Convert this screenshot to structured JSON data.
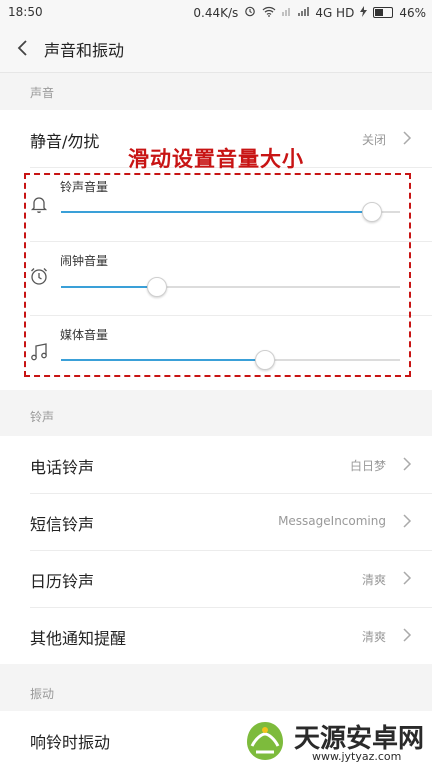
{
  "status_bar": {
    "time": "18:50",
    "speed": "0.44K/s",
    "network": "4G HD",
    "battery": "46%",
    "battery_level": 0.46
  },
  "header": {
    "title": "声音和振动"
  },
  "sound_section": {
    "label": "声音",
    "dnd": {
      "label": "静音/勿扰",
      "value": "关闭"
    },
    "volumes": [
      {
        "label": "铃声音量",
        "icon": "bell-icon",
        "level": 0.915
      },
      {
        "label": "闹钟音量",
        "icon": "alarm-clock-icon",
        "level": 0.28
      },
      {
        "label": "媒体音量",
        "icon": "music-note-icon",
        "level": 0.6
      }
    ]
  },
  "ringtone_section": {
    "label": "铃声",
    "items": [
      {
        "label": "电话铃声",
        "value": "白日梦"
      },
      {
        "label": "短信铃声",
        "value": "MessageIncoming"
      },
      {
        "label": "日历铃声",
        "value": "清爽"
      },
      {
        "label": "其他通知提醒",
        "value": "清爽"
      }
    ]
  },
  "vibration_section": {
    "label": "振动",
    "items": [
      {
        "label": "响铃时振动"
      }
    ]
  },
  "annotation": {
    "text": "滑动设置音量大小",
    "color": "#c81414"
  },
  "watermark": {
    "text": "天源安卓网",
    "url": "www.jytyaz.com"
  },
  "colors": {
    "accent": "#3aa0d8",
    "annotation": "#c81414"
  }
}
